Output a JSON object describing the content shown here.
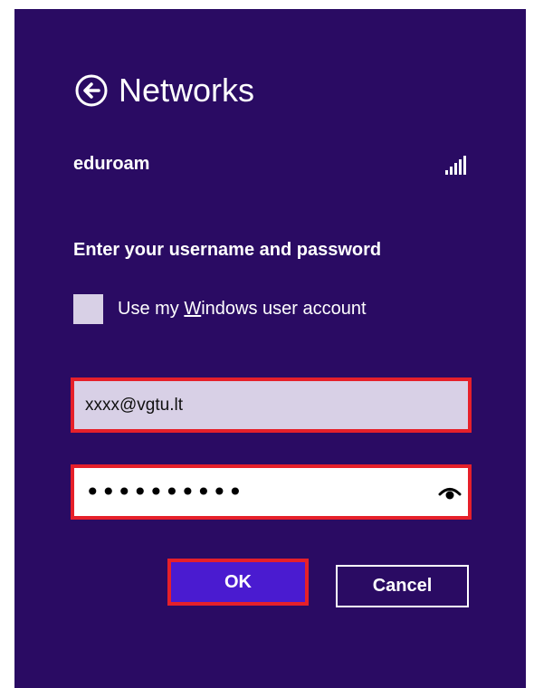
{
  "header": {
    "title": "Networks",
    "back_icon": "back-arrow-circle-icon"
  },
  "network": {
    "name": "eduroam",
    "signal_icon": "wifi-signal-icon",
    "signal_strength": "full"
  },
  "form": {
    "prompt": "Enter your username and password",
    "checkbox": {
      "label_pre": "Use my ",
      "label_mnemonic": "W",
      "label_post": "indows user account",
      "checked": false
    },
    "username": {
      "value": "xxxx@vgtu.lt"
    },
    "password": {
      "masked_value": "••••••••••",
      "reveal_icon": "eye-reveal-icon"
    }
  },
  "buttons": {
    "ok_label": "OK",
    "cancel_label": "Cancel"
  },
  "colors": {
    "background": "#2a0b63",
    "accent": "#4a1bd0",
    "highlight": "#e6202a",
    "field_bg": "#d8d0e6"
  }
}
